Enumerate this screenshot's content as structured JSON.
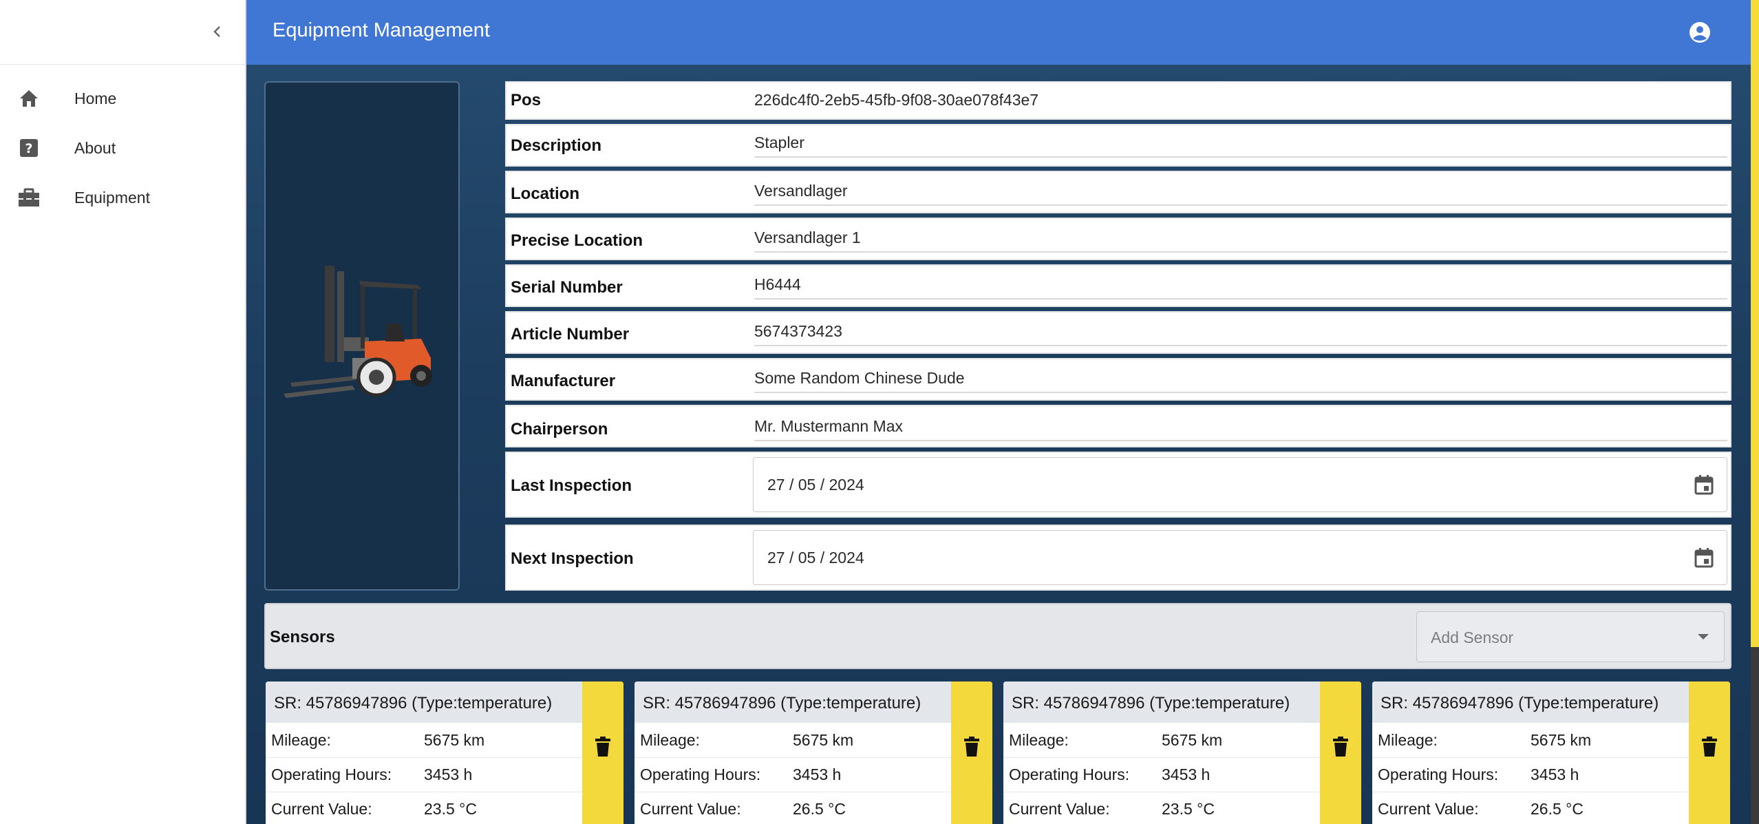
{
  "header": {
    "title": "Equipment Management"
  },
  "sidebar": {
    "items": [
      {
        "label": "Home",
        "icon": "home-icon"
      },
      {
        "label": "About",
        "icon": "help-icon"
      },
      {
        "label": "Equipment",
        "icon": "toolbox-icon"
      }
    ]
  },
  "equipment": {
    "fields": [
      {
        "label": "Pos",
        "value": "226dc4f0-2eb5-45fb-9f08-30ae078f43e7"
      },
      {
        "label": "Description",
        "value": "Stapler"
      },
      {
        "label": "Location",
        "value": "Versandlager"
      },
      {
        "label": "Precise Location",
        "value": "Versandlager 1"
      },
      {
        "label": "Serial Number",
        "value": "H6444"
      },
      {
        "label": "Article Number",
        "value": "5674373423"
      },
      {
        "label": "Manufacturer",
        "value": "Some Random Chinese Dude"
      },
      {
        "label": "Chairperson",
        "value": "Mr. Mustermann Max"
      }
    ],
    "dates": [
      {
        "label": "Last Inspection",
        "value": "27 / 05 / 2024"
      },
      {
        "label": "Next Inspection",
        "value": "27 / 05 / 2024"
      }
    ]
  },
  "sensors": {
    "title": "Sensors",
    "add_placeholder": "Add Sensor",
    "labels": {
      "mileage": "Mileage:",
      "hours": "Operating Hours:",
      "current": "Current Value:"
    },
    "cards": [
      {
        "title": "SR: 45786947896 (Type:temperature)",
        "mileage": "5675 km",
        "hours": "3453 h",
        "current": "23.5 °C"
      },
      {
        "title": "SR: 45786947896 (Type:temperature)",
        "mileage": "5675 km",
        "hours": "3453 h",
        "current": "26.5 °C"
      },
      {
        "title": "SR: 45786947896 (Type:temperature)",
        "mileage": "5675 km",
        "hours": "3453 h",
        "current": "23.5 °C"
      },
      {
        "title": "SR: 45786947896 (Type:temperature)",
        "mileage": "5675 km",
        "hours": "3453 h",
        "current": "26.5 °C"
      }
    ]
  },
  "colors": {
    "header": "#4177d4",
    "accent": "#f3d93b",
    "background": "#1d3d5e"
  }
}
